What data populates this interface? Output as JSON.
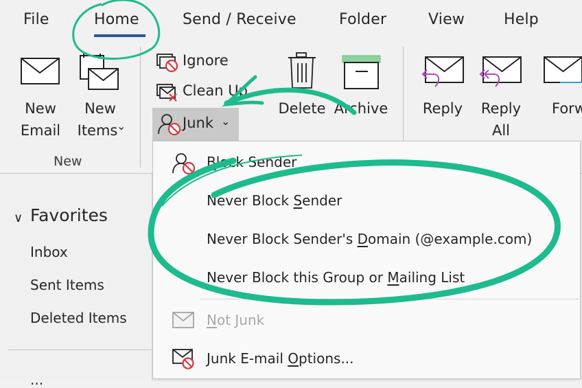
{
  "tabs": [
    {
      "label": "File",
      "active": false
    },
    {
      "label": "Home",
      "active": true
    },
    {
      "label": "Send / Receive",
      "active": false
    },
    {
      "label": "Folder",
      "active": false
    },
    {
      "label": "View",
      "active": false
    },
    {
      "label": "Help",
      "active": false
    }
  ],
  "ribbon": {
    "new_email": {
      "line1": "New",
      "line2": "Email"
    },
    "new_items": {
      "line1": "New",
      "line2": "Items",
      "chevron": "⌄"
    },
    "new_group_label": "New",
    "ignore": "Ignore",
    "clean_up": "Clean Up",
    "junk": "Junk",
    "delete": "Delete",
    "archive": "Archive",
    "reply": "Reply",
    "reply_all": {
      "line1": "Reply",
      "line2": "All"
    },
    "forward": "Forward"
  },
  "nav": {
    "favorites_label": "Favorites",
    "items": [
      "Inbox",
      "Sent Items",
      "Deleted Items"
    ],
    "partial_account": "..."
  },
  "junk_menu": {
    "items": [
      {
        "pre": "",
        "access": "B",
        "post": "lock Sender",
        "icon": "block-sender-icon",
        "disabled": false
      },
      {
        "pre": "Never Block ",
        "access": "S",
        "post": "ender",
        "icon": "",
        "disabled": false
      },
      {
        "pre": "Never Block Sender's ",
        "access": "D",
        "post": "omain (@example.com)",
        "icon": "",
        "disabled": false
      },
      {
        "pre": "Never Block this Group or ",
        "access": "M",
        "post": "ailing List",
        "icon": "",
        "disabled": false
      },
      {
        "pre": "",
        "access": "N",
        "post": "ot Junk",
        "icon": "not-junk-icon",
        "disabled": true
      },
      {
        "pre": "Junk E-mail ",
        "access": "O",
        "post": "ptions...",
        "icon": "junk-options-icon",
        "disabled": false
      }
    ]
  },
  "colors": {
    "accent_tab_underline": "#2b5797",
    "annotation_green": "#1dbb8e",
    "block_red": "#d9363e",
    "archive_green": "#8fd19e",
    "reply_purple": "#b146c2",
    "forward_blue": "#2f9fd8"
  }
}
